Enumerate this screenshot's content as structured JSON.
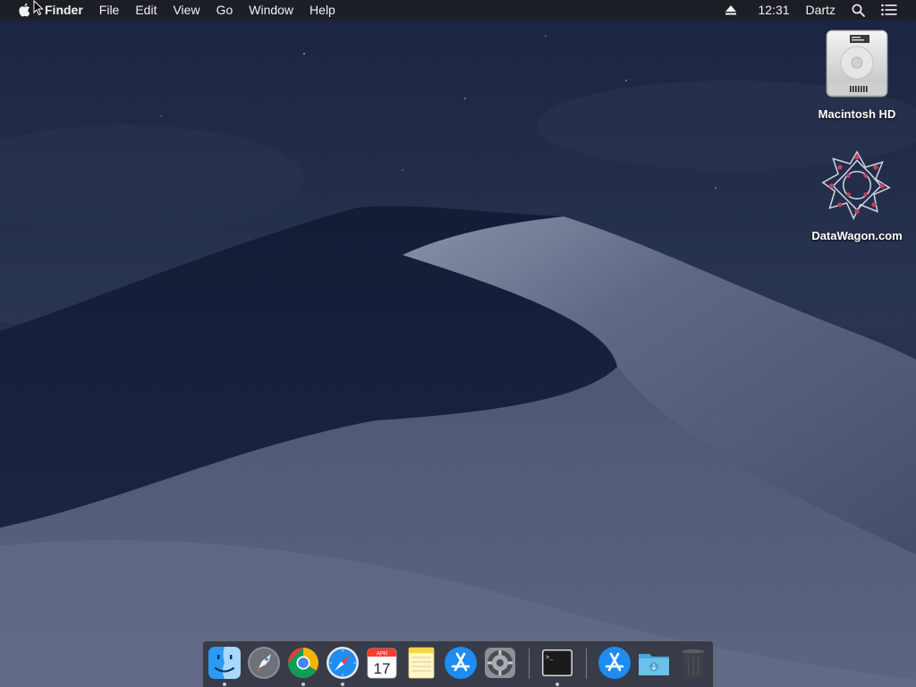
{
  "menubar": {
    "app_name": "Finder",
    "menus": [
      "File",
      "Edit",
      "View",
      "Go",
      "Window",
      "Help"
    ],
    "clock": "12:31",
    "user": "Dartz"
  },
  "desktop_icons": [
    {
      "label": "Macintosh HD",
      "icon": "hard-drive-icon"
    },
    {
      "label": "DataWagon.com",
      "icon": "datawagon-logo-icon"
    }
  ],
  "dock": {
    "items": [
      {
        "name": "finder",
        "icon": "finder-icon",
        "running": true
      },
      {
        "name": "launchpad",
        "icon": "rocket-icon",
        "running": false
      },
      {
        "name": "chrome",
        "icon": "chrome-icon",
        "running": true
      },
      {
        "name": "safari",
        "icon": "compass-icon",
        "running": true
      },
      {
        "name": "calendar",
        "icon": "calendar-icon",
        "running": false,
        "month": "APR",
        "day": "17"
      },
      {
        "name": "notes",
        "icon": "notes-icon",
        "running": false
      },
      {
        "name": "app-store",
        "icon": "app-store-icon",
        "running": false
      },
      {
        "name": "system-preferences",
        "icon": "gear-icon",
        "running": false
      },
      {
        "name": "terminal",
        "icon": "terminal-icon",
        "running": true,
        "prompt": ">_"
      },
      {
        "name": "app-store-2",
        "icon": "app-store-icon",
        "running": false
      },
      {
        "name": "downloads",
        "icon": "folder-icon",
        "running": false
      },
      {
        "name": "trash",
        "icon": "trash-icon",
        "running": false
      }
    ]
  },
  "colors": {
    "menubar_bg": "#1c1e24",
    "sky_top": "#1d2740",
    "dune_light": "#6a7290",
    "dune_dark": "#121a33"
  }
}
